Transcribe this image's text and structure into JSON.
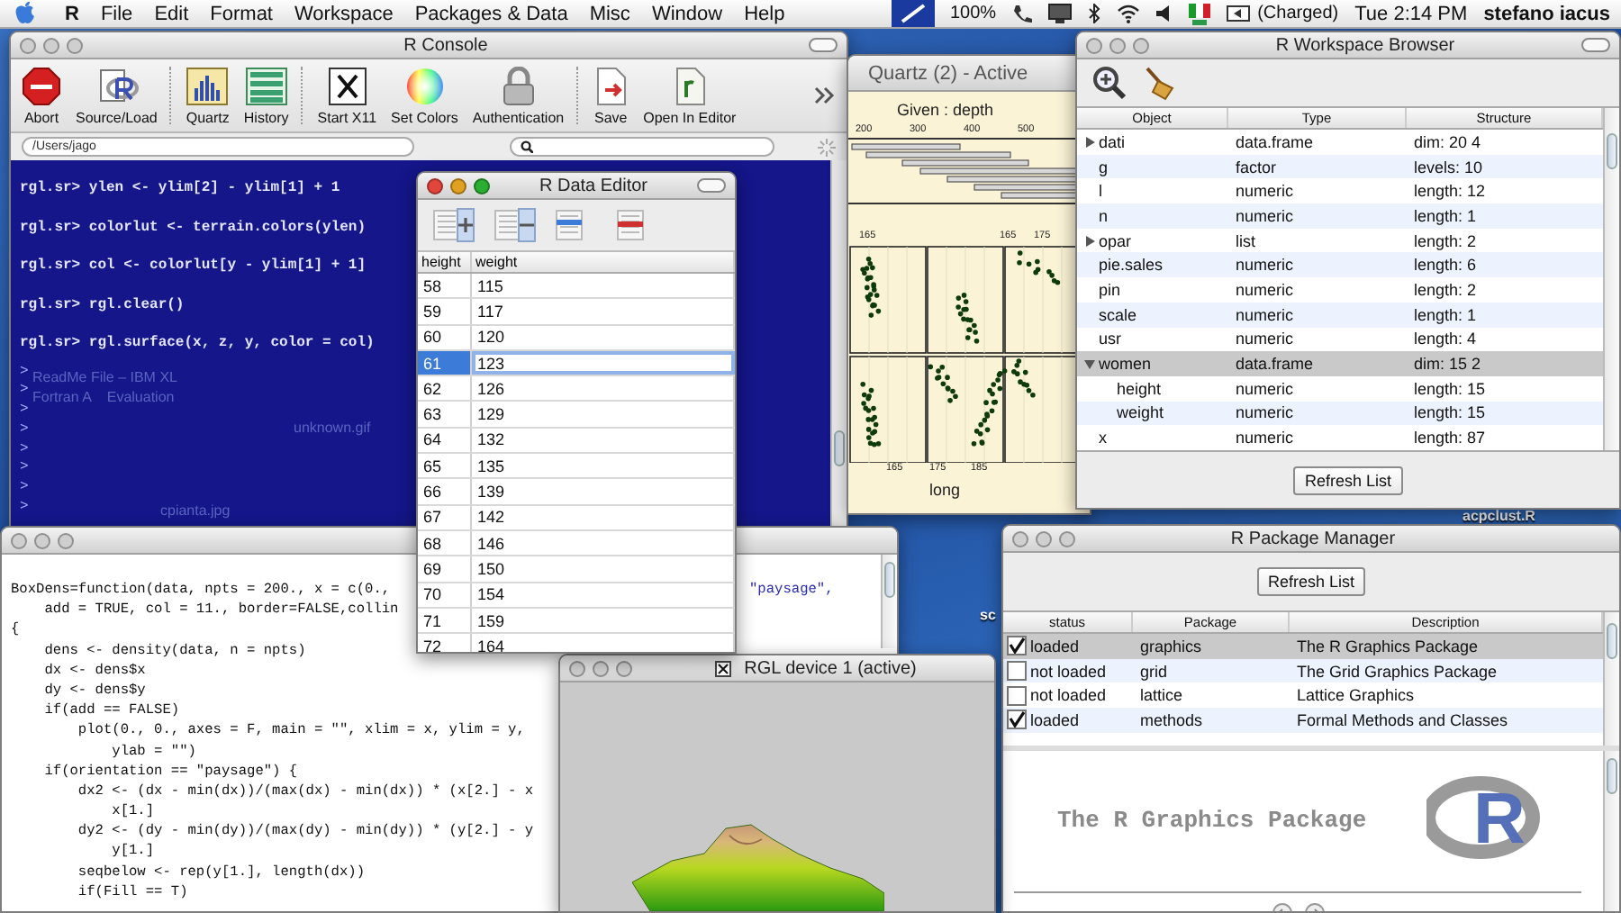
{
  "menubar": {
    "items": [
      {
        "label": "R",
        "kind": "app"
      },
      {
        "label": "File",
        "kind": "menu"
      },
      {
        "label": "Edit",
        "kind": "menu"
      },
      {
        "label": "Format",
        "kind": "menu"
      },
      {
        "label": "Workspace",
        "kind": "menu"
      },
      {
        "label": "Packages & Data",
        "kind": "menu"
      },
      {
        "label": "Misc",
        "kind": "menu"
      },
      {
        "label": "Window",
        "kind": "menu"
      },
      {
        "label": "Help",
        "kind": "menu"
      }
    ],
    "status": {
      "battery": "100%",
      "charge": "(Charged)",
      "clock": "Tue 2:14 PM",
      "user": "stefano iacus"
    }
  },
  "desktop_labels": [
    "acpclust.R",
    "sc"
  ],
  "console": {
    "title": "R Console",
    "active": false,
    "toolbar": [
      {
        "label": "Abort",
        "kind": "stop",
        "separated": false
      },
      {
        "label": "Source/Load",
        "kind": "source",
        "separated": false
      },
      {
        "label": "Quartz",
        "kind": "quartz",
        "separated": true
      },
      {
        "label": "History",
        "kind": "history",
        "separated": false
      },
      {
        "label": "Start X11",
        "kind": "x11",
        "separated": true
      },
      {
        "label": "Set Colors",
        "kind": "colors",
        "separated": false
      },
      {
        "label": "Authentication",
        "kind": "lock",
        "separated": false
      },
      {
        "label": "Save",
        "kind": "save",
        "separated": true
      },
      {
        "label": "Open In Editor",
        "kind": "editor",
        "separated": false
      }
    ],
    "path": "/Users/jago",
    "lines": [
      "rgl.sr> ylen <- ylim[2] - ylim[1] + 1",
      "rgl.sr> colorlut <- terrain.colors(ylen)",
      "rgl.sr> col <- colorlut[y - ylim[1] + 1]",
      "rgl.sr> rgl.clear()",
      "rgl.sr> rgl.surface(x, z, y, color = col)"
    ],
    "prompts": [
      ">",
      ">",
      ">",
      ">",
      ">",
      ">",
      ">",
      ">"
    ],
    "background_labels": [
      "ReadMe File – IBM XL",
      "Fortran A    Evaluation",
      "unknown.gif",
      "cpianta.jpg"
    ]
  },
  "quartz": {
    "title": "Quartz (2) - Active",
    "given": "Given : depth",
    "top_ticks": [
      "200",
      "300",
      "400",
      "500"
    ],
    "panel_ticks": [
      "165",
      "165",
      "175"
    ],
    "bottom_ticks": [
      "165",
      "175",
      "185"
    ],
    "xlabel": "long"
  },
  "code_editor": {
    "active": false,
    "lines": [
      {
        "text": "BoxDens=function(data, npts = 200., x = c(0.,",
        "tail": "\"paysage\","
      },
      {
        "text": "    add = TRUE, col = 11., border=FALSE,collin"
      },
      {
        "text": "{"
      },
      {
        "text": "    dens <- density(data, n = npts)"
      },
      {
        "text": "    dx <- dens$x"
      },
      {
        "text": "    dy <- dens$y"
      },
      {
        "text": "    if(add == FALSE)"
      },
      {
        "text": "        plot(0., 0., axes = F, main = \"\", xlim = x, ylim = y,"
      },
      {
        "text": "            ylab = \"\")"
      },
      {
        "text": "    if(orientation == \"paysage\") {"
      },
      {
        "text": "        dx2 <- (dx - min(dx))/(max(dx) - min(dx)) * (x[2.] - x"
      },
      {
        "text": "            x[1.]"
      },
      {
        "text": "        dy2 <- (dy - min(dy))/(max(dy) - min(dy)) * (y[2.] - y"
      },
      {
        "text": "            y[1.]"
      },
      {
        "text": "        seqbelow <- rep(y[1.], length(dx))"
      },
      {
        "text": "        if(Fill == T)"
      }
    ]
  },
  "data_editor": {
    "title": "R Data Editor",
    "active": true,
    "columns": [
      "height",
      "weight"
    ],
    "rows": [
      {
        "cells": [
          "58",
          "115"
        ],
        "selected": false
      },
      {
        "cells": [
          "59",
          "117"
        ],
        "selected": false
      },
      {
        "cells": [
          "60",
          "120"
        ],
        "selected": false
      },
      {
        "cells": [
          "61",
          "123"
        ],
        "selected": true
      },
      {
        "cells": [
          "62",
          "126"
        ],
        "selected": false
      },
      {
        "cells": [
          "63",
          "129"
        ],
        "selected": false
      },
      {
        "cells": [
          "64",
          "132"
        ],
        "selected": false
      },
      {
        "cells": [
          "65",
          "135"
        ],
        "selected": false
      },
      {
        "cells": [
          "66",
          "139"
        ],
        "selected": false
      },
      {
        "cells": [
          "67",
          "142"
        ],
        "selected": false
      },
      {
        "cells": [
          "68",
          "146"
        ],
        "selected": false
      },
      {
        "cells": [
          "69",
          "150"
        ],
        "selected": false
      },
      {
        "cells": [
          "70",
          "154"
        ],
        "selected": false
      },
      {
        "cells": [
          "71",
          "159"
        ],
        "selected": false
      },
      {
        "cells": [
          "72",
          "164"
        ],
        "selected": false
      }
    ]
  },
  "workspace": {
    "title": "R Workspace Browser",
    "active": false,
    "columns": [
      "Object",
      "Type",
      "Structure"
    ],
    "rows": [
      {
        "cells": [
          "dati",
          "data.frame",
          "dim: 20 4"
        ],
        "expanded": false,
        "selected": false
      },
      {
        "cells": [
          "g",
          "factor",
          "levels: 10"
        ],
        "selected": false
      },
      {
        "cells": [
          "l",
          "numeric",
          "length: 12"
        ],
        "selected": false
      },
      {
        "cells": [
          "n",
          "numeric",
          "length: 1"
        ],
        "selected": false
      },
      {
        "cells": [
          "opar",
          "list",
          "length: 2"
        ],
        "expanded": false,
        "selected": false
      },
      {
        "cells": [
          "pie.sales",
          "numeric",
          "length: 6"
        ],
        "selected": false
      },
      {
        "cells": [
          "pin",
          "numeric",
          "length: 2"
        ],
        "selected": false
      },
      {
        "cells": [
          "scale",
          "numeric",
          "length: 1"
        ],
        "selected": false
      },
      {
        "cells": [
          "usr",
          "numeric",
          "length: 4"
        ],
        "selected": false
      },
      {
        "cells": [
          "women",
          "data.frame",
          "dim: 15 2"
        ],
        "expanded": true,
        "selected": true,
        "children": [
          {
            "cells": [
              "height",
              "numeric",
              "length: 15"
            ],
            "selected": false
          },
          {
            "cells": [
              "weight",
              "numeric",
              "length: 15"
            ],
            "selected": false
          }
        ]
      },
      {
        "cells": [
          "x",
          "numeric",
          "length: 87"
        ],
        "selected": false
      }
    ],
    "button": "Refresh List"
  },
  "package_manager": {
    "title": "R Package Manager",
    "active": false,
    "button": "Refresh List",
    "columns": [
      "status",
      "Package",
      "Description"
    ],
    "rows": [
      {
        "loaded": true,
        "status": "loaded",
        "package": "graphics",
        "description": "The R Graphics Package",
        "selected": true
      },
      {
        "loaded": false,
        "status": "not loaded",
        "package": "grid",
        "description": "The Grid Graphics Package",
        "selected": false
      },
      {
        "loaded": false,
        "status": "not loaded",
        "package": "lattice",
        "description": "Lattice Graphics",
        "selected": false
      },
      {
        "loaded": true,
        "status": "loaded",
        "package": "methods",
        "description": "Formal Methods and Classes",
        "selected": false
      }
    ],
    "help": {
      "title": "The R Graphics Package",
      "logo_text": "R"
    }
  },
  "rgl": {
    "title": "RGL device 1 (active)",
    "active": false
  }
}
